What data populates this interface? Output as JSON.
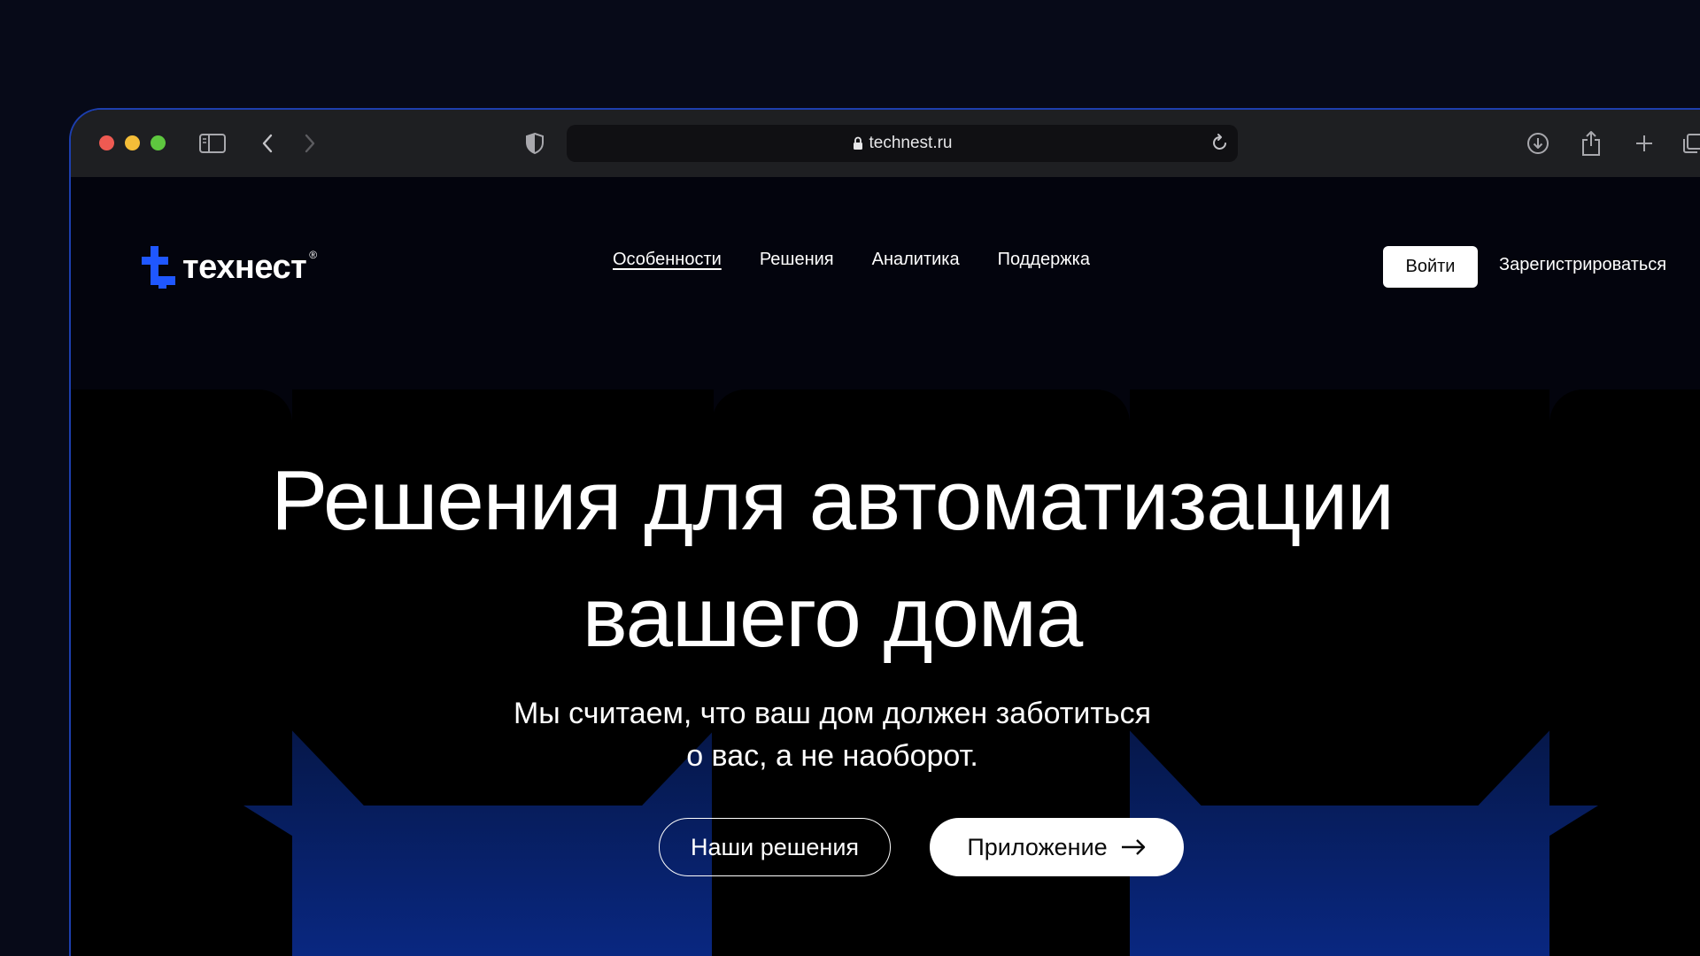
{
  "browser": {
    "url": "technest.ru",
    "icons": {
      "sidebar": "sidebar-icon",
      "back": "chevron-left-icon",
      "forward": "chevron-right-icon",
      "privacy": "shield-icon",
      "lock": "lock-icon",
      "reload": "reload-icon",
      "download": "download-icon",
      "share": "share-icon",
      "new_tab": "plus-icon",
      "tabs": "tabs-overview-icon"
    }
  },
  "site": {
    "logo_text": "технест",
    "logo_reg": "®",
    "accent": "#1f57ff",
    "nav": [
      {
        "label": "Особенности",
        "active": true
      },
      {
        "label": "Решения",
        "active": false
      },
      {
        "label": "Аналитика",
        "active": false
      },
      {
        "label": "Поддержка",
        "active": false
      }
    ],
    "login_label": "Войти",
    "register_label": "Зарегистрироваться"
  },
  "hero": {
    "title_line1": "Решения для автоматизации",
    "title_line2": "вашего дома",
    "subtitle_line1": "Мы считаем, что ваш дом должен заботиться",
    "subtitle_line2": "о вас, а не наоборот.",
    "primary_button": "Наши решения",
    "secondary_button": "Приложение"
  }
}
